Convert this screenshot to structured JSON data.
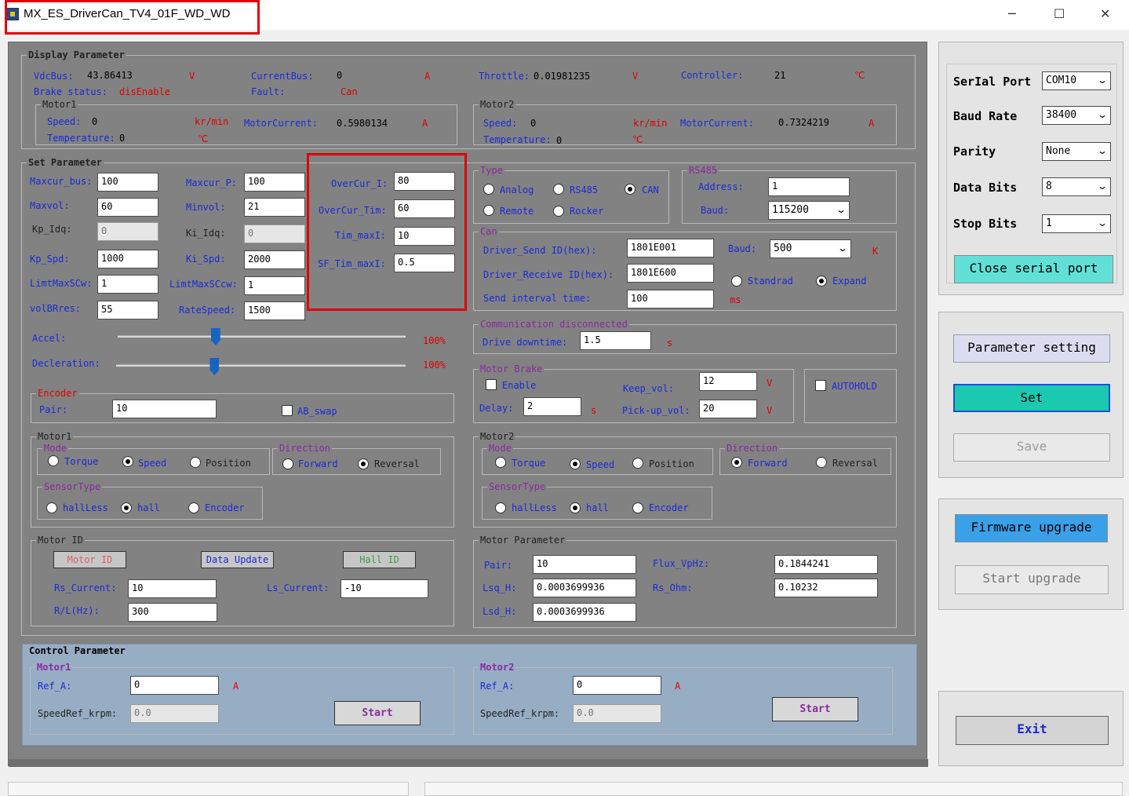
{
  "window": {
    "title": "MX_ES_DriverCan_TV4_01F_WD_WD",
    "minimize": "─",
    "maximize": "☐",
    "close": "✕"
  },
  "display": {
    "group": "Display Parameter",
    "vdcbus_label": "VdcBus:",
    "vdcbus_value": "43.86413",
    "vdcbus_unit": "V",
    "currentbus_label": "CurrentBus:",
    "currentbus_value": "0",
    "currentbus_unit": "A",
    "throttle_label": "Throttle:",
    "throttle_value": "0.01981235",
    "throttle_unit": "V",
    "controller_label": "Controller:",
    "controller_value": "21",
    "controller_unit": "℃",
    "brake_label": "Brake status:",
    "brake_value": "disEnable",
    "fault_label": "Fault:",
    "fault_value": "Can",
    "motor1": {
      "group": "Motor1",
      "speed_label": "Speed:",
      "speed_value": "0",
      "speed_unit": "kr/min",
      "current_label": "MotorCurrent:",
      "current_value": "0.5980134",
      "current_unit": "A",
      "temp_label": "Temperature:",
      "temp_value": "0",
      "temp_unit": "℃"
    },
    "motor2": {
      "group": "Motor2",
      "speed_label": "Speed:",
      "speed_value": "0",
      "speed_unit": "kr/min",
      "current_label": "MotorCurrent:",
      "current_value": "0.7324219",
      "current_unit": "A",
      "temp_label": "Temperature:",
      "temp_value": "0",
      "temp_unit": "℃"
    }
  },
  "setparam": {
    "group": "Set Parameter",
    "maxcur_bus_label": "Maxcur_bus:",
    "maxcur_bus": "100",
    "maxvol_label": "Maxvol:",
    "maxvol": "60",
    "kp_idq_label": "Kp_Idq:",
    "kp_idq": "0",
    "kp_spd_label": "Kp_Spd:",
    "kp_spd": "1000",
    "limtmaxscw_label": "LimtMaxSCw:",
    "limtmaxscw": "1",
    "volbrres_label": "volBRres:",
    "volbrres": "55",
    "maxcur_p_label": "Maxcur_P:",
    "maxcur_p": "100",
    "minvol_label": "Minvol:",
    "minvol": "21",
    "ki_idq_label": "Ki_Idq:",
    "ki_idq": "0",
    "ki_spd_label": "Ki_Spd:",
    "ki_spd": "2000",
    "limtmaxsccw_label": "LimtMaxSCcw:",
    "limtmaxsccw": "1",
    "ratespeed_label": "RateSpeed:",
    "ratespeed": "1500",
    "overcur_i_label": "OverCur_I:",
    "overcur_i": "80",
    "overcur_tim_label": "OverCur_Tim:",
    "overcur_tim": "60",
    "tim_maxi_label": "Tim_maxI:",
    "tim_maxi": "10",
    "sf_tim_maxi_label": "SF_Tim_maxI:",
    "sf_tim_maxi": "0.5",
    "accel_label": "Accel:",
    "accel_pct": "100%",
    "accel_pos": 0.34,
    "decel_label": "Decleration:",
    "decel_pct": "100%",
    "decel_pos": 0.34,
    "encoder": {
      "group": "Encoder",
      "pair_label": "Pair:",
      "pair": "10",
      "ab_swap": "AB_swap"
    }
  },
  "type": {
    "group": "Type",
    "analog": "Analog",
    "rs485": "RS485",
    "can": "CAN",
    "remote": "Remote",
    "rocker": "Rocker"
  },
  "rs485": {
    "group": "RS485",
    "address_label": "Address:",
    "address": "1",
    "baud_label": "Baud:",
    "baud": "115200"
  },
  "can": {
    "group": "Can",
    "send_label": "Driver_Send ID(hex):",
    "send": "1801E001",
    "receive_label": "Driver_Receive ID(hex):",
    "receive": "1801E600",
    "interval_label": "Send interval time:",
    "interval": "100",
    "interval_unit": "ms",
    "baud_label": "Baud:",
    "baud": "500",
    "baud_unit": "K",
    "standrad": "Standrad",
    "expand": "Expand"
  },
  "comm": {
    "group": "Communication disconnected",
    "downtime_label": "Drive downtime:",
    "downtime": "1.5",
    "downtime_unit": "s"
  },
  "brake": {
    "group": "Motor Brake",
    "enable": "Enable",
    "delay_label": "Delay:",
    "delay": "2",
    "delay_unit": "s",
    "keep_label": "Keep_vol:",
    "keep": "12",
    "keep_unit": "V",
    "pickup_label": "Pick-up_vol:",
    "pickup": "20",
    "pickup_unit": "V",
    "autohold": "AUTOHOLD"
  },
  "motor1": {
    "group": "Motor1",
    "mode_group": "Mode",
    "torque": "Torque",
    "speed": "Speed",
    "position": "Position",
    "dir_group": "Direction",
    "forward": "Forward",
    "reversal": "Reversal",
    "sensor_group": "SensorType",
    "hallless": "hallLess",
    "hall": "hall",
    "encoder": "Encoder"
  },
  "motor2": {
    "group": "Motor2",
    "mode_group": "Mode",
    "torque": "Torque",
    "speed": "Speed",
    "position": "Position",
    "dir_group": "Direction",
    "forward": "Forward",
    "reversal": "Reversal",
    "sensor_group": "SensorType",
    "hallless": "hallLess",
    "hall": "hall",
    "encoder": "Encoder"
  },
  "motorid": {
    "group": "Motor ID",
    "motor_id_btn": "Motor ID",
    "data_update_btn": "Data Update",
    "hall_id_btn": "Hall ID",
    "rs_label": "Rs_Current:",
    "rs": "10",
    "ls_label": "Ls_Current:",
    "ls": "-10",
    "rl_label": "R/L(Hz):",
    "rl": "300"
  },
  "motorparam": {
    "group": "Motor Parameter",
    "pair_label": "Pair:",
    "pair": "10",
    "lsq_label": "Lsq_H:",
    "lsq": "0.0003699936",
    "lsd_label": "Lsd_H:",
    "lsd": "0.0003699936",
    "flux_label": "Flux_VpHz:",
    "flux": "0.1844241",
    "rs_label": "Rs_Ohm:",
    "rs": "0.10232"
  },
  "control": {
    "group": "Control Parameter",
    "m1": {
      "group": "Motor1",
      "ref_label": "Ref_A:",
      "ref": "0",
      "ref_unit": "A",
      "spd_label": "SpeedRef_krpm:",
      "spd": "0.0",
      "start": "Start"
    },
    "m2": {
      "group": "Motor2",
      "ref_label": "Ref_A:",
      "ref": "0",
      "ref_unit": "A",
      "spd_label": "SpeedRef_krpm:",
      "spd": "0.0",
      "start": "Start"
    }
  },
  "serial": {
    "port_label": "SerIal Port",
    "port": "COM10",
    "baud_label": "Baud Rate",
    "baud": "38400",
    "parity_label": "Parity",
    "parity": "None",
    "databits_label": "Data Bits",
    "databits": "8",
    "stopbits_label": "Stop Bits",
    "stopbits": "1",
    "close_btn": "Close serial port"
  },
  "actions": {
    "param_setting": "Parameter setting",
    "set": "Set",
    "save": "Save",
    "firmware": "Firmware upgrade",
    "start_upgrade": "Start upgrade",
    "exit": "Exit"
  },
  "colors": {
    "panel": "#828282",
    "control_panel": "#97adc4",
    "label_blue": "#1a2bd6",
    "unit_red": "#e00000",
    "group_purple": "#8a2aa0",
    "set_btn": "#1ac9b0",
    "close_btn": "#62e0d8",
    "firmware_btn": "#3aa0e8"
  }
}
